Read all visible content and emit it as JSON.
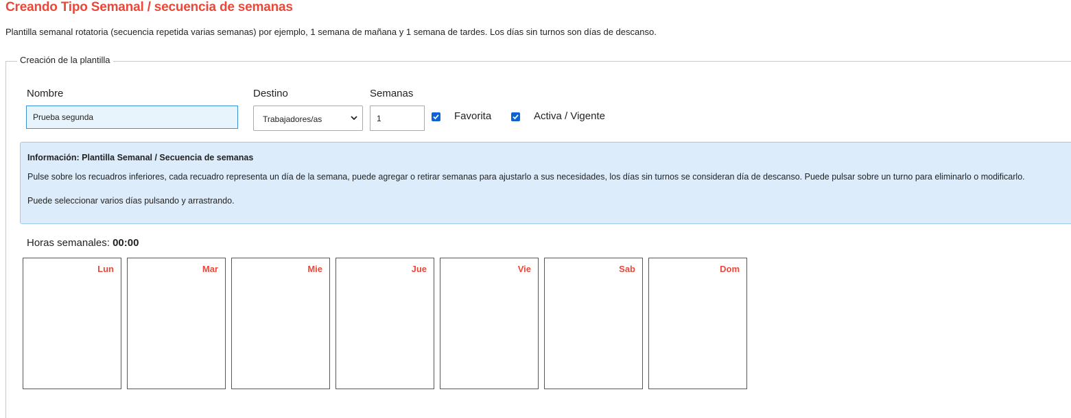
{
  "header": {
    "title": "Creando Tipo Semanal / secuencia de semanas",
    "description": "Plantilla semanal rotatoria (secuencia repetida varias semanas) por ejemplo, 1 semana de mañana y 1 semana de tardes. Los días sin turnos son días de descanso."
  },
  "form": {
    "legend": "Creación de la plantilla",
    "name_label": "Nombre",
    "name_value": "Prueba segunda",
    "destination_label": "Destino",
    "destination_value": "Trabajadores/as",
    "weeks_label": "Semanas",
    "weeks_value": "1",
    "favorite_label": "Favorita",
    "favorite_checked": true,
    "active_label": "Activa / Vigente",
    "active_checked": true
  },
  "info": {
    "title": "Información: Plantilla Semanal / Secuencia de semanas",
    "paragraph1": "Pulse sobre los recuadros inferiores, cada recuadro representa un día de la semana, puede agregar o retirar semanas para ajustarlo a sus necesidades, los días sin turnos se consideran día de descanso. Puede pulsar sobre un turno para eliminarlo o modificarlo.",
    "paragraph2": "Puede seleccionar varios días pulsando y arrastrando."
  },
  "hours": {
    "label": "Horas semanales:",
    "value": "00:00"
  },
  "days": [
    "Lun",
    "Mar",
    "Mie",
    "Jue",
    "Vie",
    "Sab",
    "Dom"
  ],
  "colors": {
    "accent": "#e8493a",
    "info_background": "#dcecfb",
    "checkbox": "#0b63d6"
  }
}
